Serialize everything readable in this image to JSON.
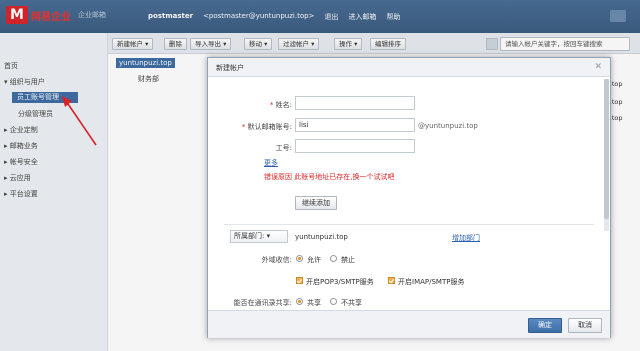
{
  "header": {
    "logo_mark": "M",
    "logo_text": "网易企业",
    "logo_sub": "企业邮箱",
    "user": "postmaster",
    "email": "<postmaster@yuntunpuzi.top>",
    "links": [
      "退出",
      "进入邮箱",
      "帮助"
    ]
  },
  "sidebar": {
    "items": [
      {
        "label": "首页"
      },
      {
        "label": "▾ 组织与用户"
      },
      {
        "label": "员工账号管理"
      },
      {
        "label": "分级管理员"
      },
      {
        "label": "▸ 企业定制"
      },
      {
        "label": "▸ 邮箱业务"
      },
      {
        "label": "▸ 帐号安全"
      },
      {
        "label": "▸ 云应用"
      },
      {
        "label": "▸ 平台设置"
      }
    ]
  },
  "toolbar": {
    "buttons": [
      "新建帐户 ▾",
      "删除",
      "导入导出 ▾",
      "移动 ▾",
      "过滤帐户 ▾",
      "操作 ▾",
      "编辑排序"
    ],
    "search_placeholder": "请输入帐户关键字，按回车键搜索"
  },
  "tree": {
    "root": "yuntunpuzi.top",
    "child": "财务部"
  },
  "list_right": [
    "i.top",
    "i.top",
    "i.top"
  ],
  "modal": {
    "title": "新建帐户",
    "close": "✕",
    "name_label": "姓名:",
    "account_label": "默认邮箱账号:",
    "account_value": "lisi",
    "account_suffix": "@yuntunpuzi.top",
    "job_label": "工号:",
    "more_link": "更多",
    "error_text": "错误原因   此账号地址已存在,换一个试试吧",
    "continue_button": "继续添加",
    "dept_select": "所属部门: ▾",
    "dept_value": "yuntunpuzi.top",
    "add_dept_link": "增加部门",
    "external_label": "外域收信:",
    "allow": "允许",
    "forbid": "禁止",
    "pop3": "开启POP3/SMTP服务",
    "imap": "开启IMAP/SMTP服务",
    "share_label": "能否在通讯录共享:",
    "share": "共享",
    "no_share": "不共享",
    "ok": "确定",
    "cancel": "取消"
  }
}
